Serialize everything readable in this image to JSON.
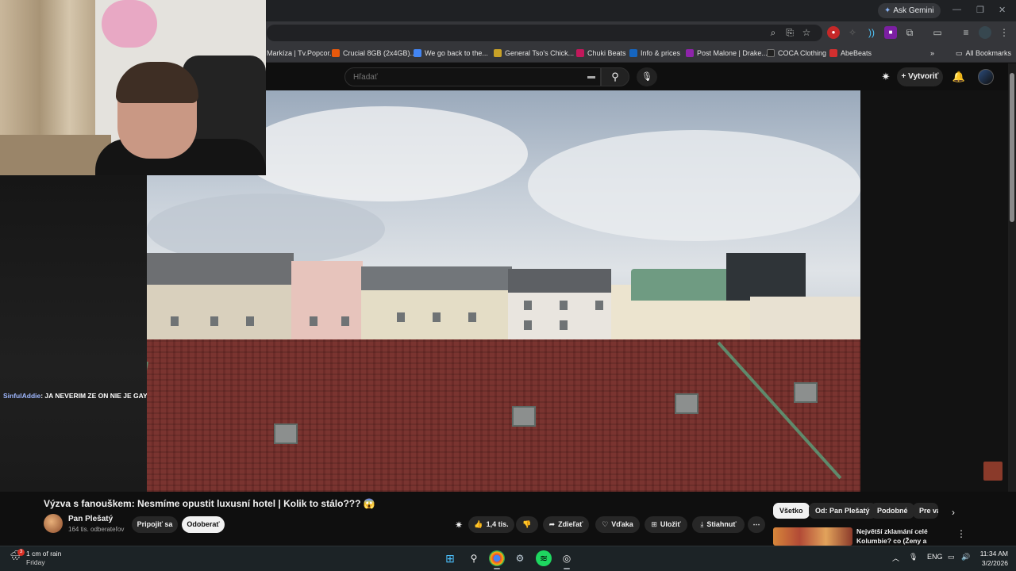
{
  "browser": {
    "ask_gemini": "Ask Gemini",
    "bookmarks": [
      {
        "label": "Markíza | Tv.Popcor...",
        "color": "#1a1a1a"
      },
      {
        "label": "Crucial 8GB (2x4GB)...",
        "color": "#e8590c"
      },
      {
        "label": "We go back to the...",
        "color": "#4285f4"
      },
      {
        "label": "General Tso's Chick...",
        "color": "#c9a227"
      },
      {
        "label": "Chuki Beats",
        "color": "#c2185b"
      },
      {
        "label": "Info & prices",
        "color": "#1565c0"
      },
      {
        "label": "Post Malone | Drake...",
        "color": "#8e24aa"
      },
      {
        "label": "COCA Clothing",
        "color": "#222222"
      },
      {
        "label": "AbeBeats",
        "color": "#d32f2f"
      }
    ],
    "all_bookmarks": "All Bookmarks"
  },
  "youtube": {
    "search_placeholder": "Hľadať",
    "create_label": "Vytvoriť"
  },
  "chat": {
    "user": "SinfulAddie",
    "message": ": JA NEVERIM ZE ON NIE JE GAY"
  },
  "video": {
    "title": "Výzva s fanouškem: Nesmíme opustit luxusní hotel | Kolik to stálo??? 😱",
    "channel_name": "Pan Plešatý",
    "subscribers": "164 tis. odberateľov",
    "join_label": "Pripojiť sa",
    "subscribe_label": "Odoberať",
    "likes": "1,4 tis.",
    "share_label": "Zdieľať",
    "thanks_label": "Vďaka",
    "save_label": "Uložiť",
    "download_label": "Stiahnuť"
  },
  "chips": [
    "Všetko",
    "Od: Pan Plešatý",
    "Podobné",
    "Pre vás"
  ],
  "recommendation": {
    "title": "Největší zklamání celé Kolumbie? co (Ženy a Krádeže)"
  },
  "taskbar": {
    "weather_text": "1 cm of rain",
    "weather_day": "Friday",
    "weather_badge": "3",
    "lang": "ENG",
    "time": "11:34 AM",
    "date": "3/2/2026"
  }
}
